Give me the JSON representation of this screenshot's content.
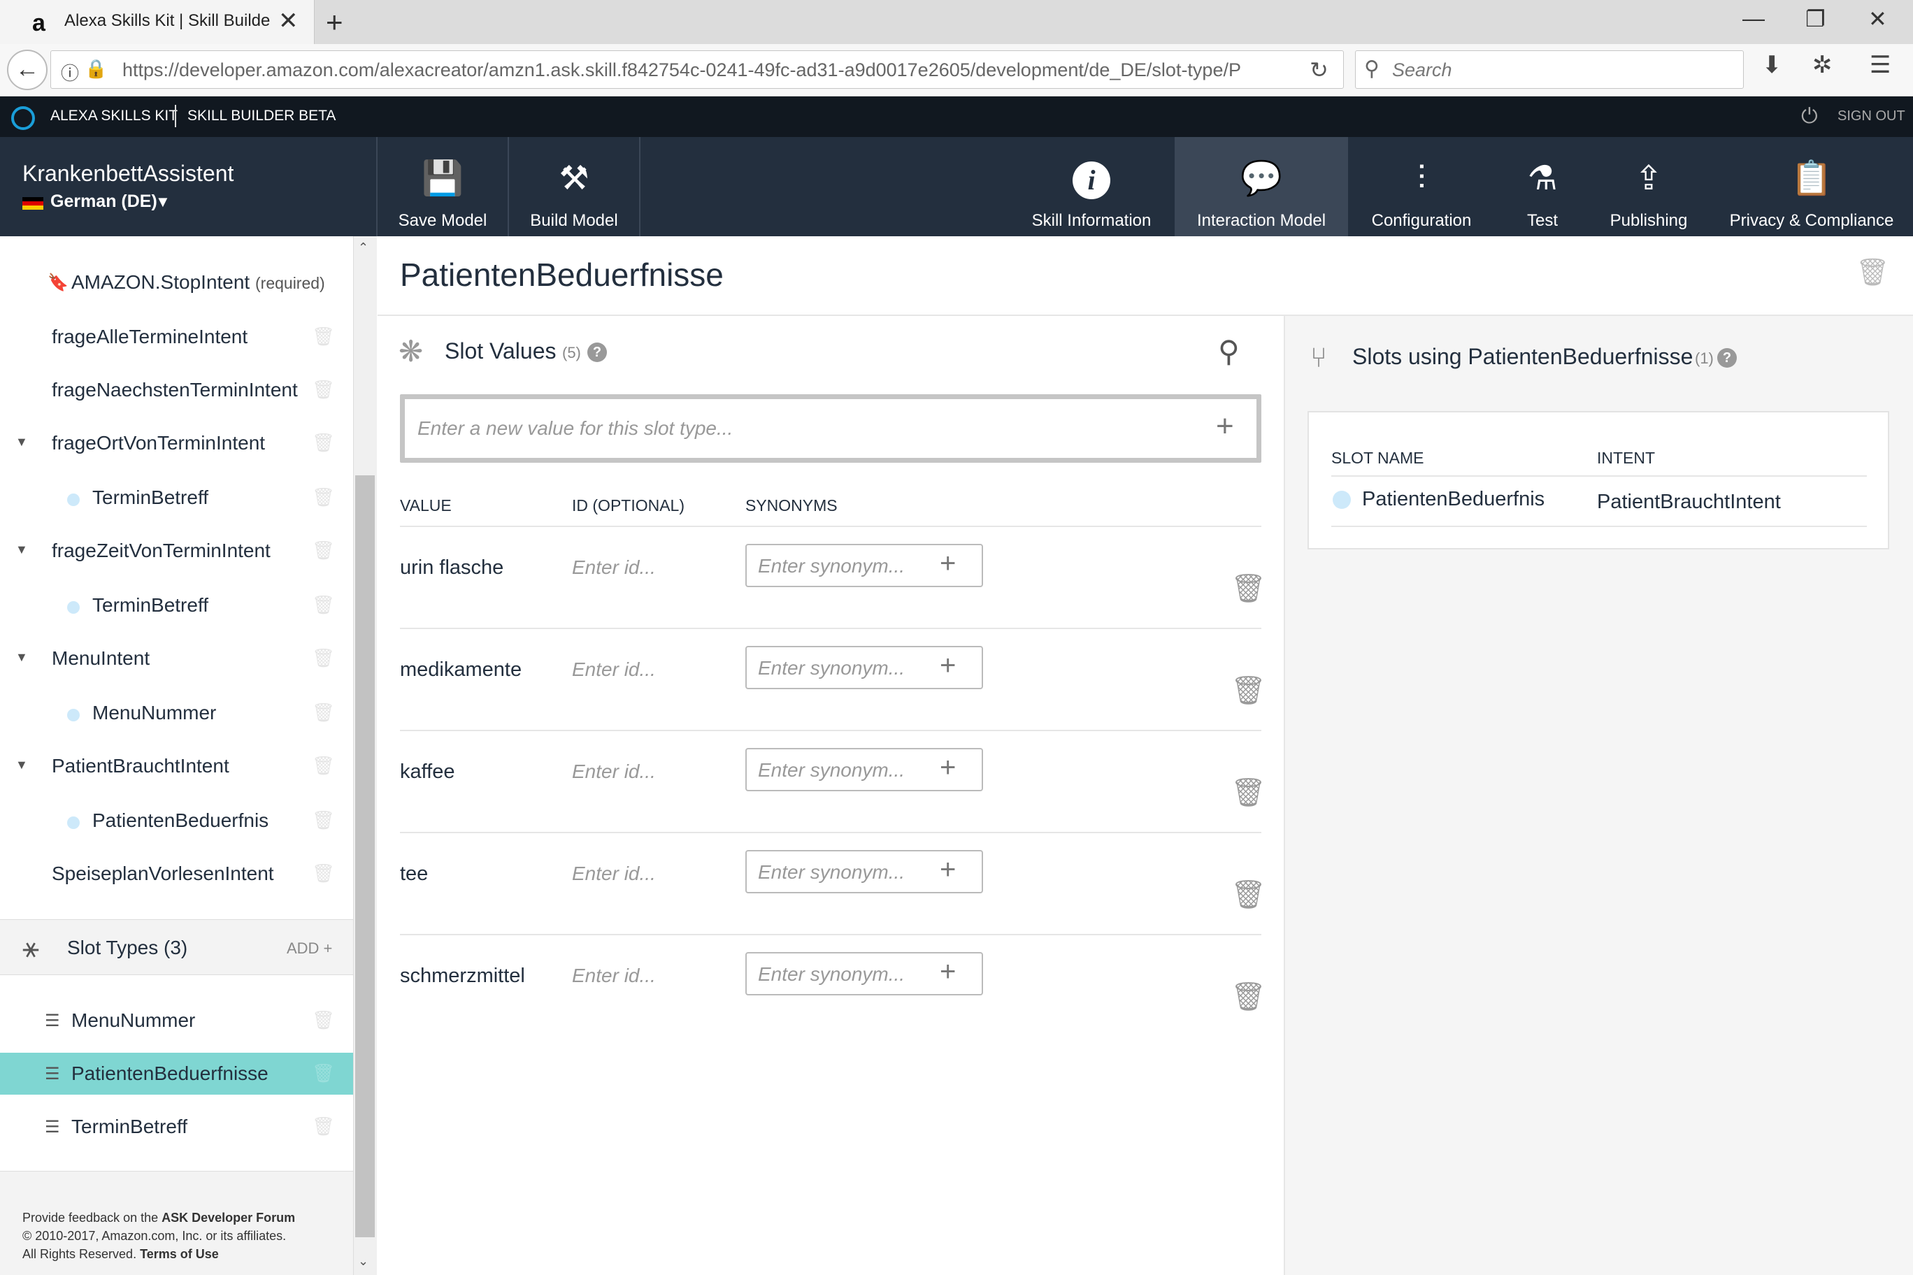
{
  "browser": {
    "tab_title": "Alexa Skills Kit | Skill Builder",
    "favicon": "a",
    "url": "https://developer.amazon.com/alexacreator/amzn1.ask.skill.f842754c-0241-49fc-ad31-a9d0017e2605/development/de_DE/slot-type/P",
    "search_placeholder": "Search"
  },
  "ask_bar": {
    "title": "ALEXA SKILLS KIT",
    "subtitle": "SKILL BUILDER BETA",
    "sign_out": "SIGN OUT"
  },
  "skill": {
    "name": "KrankenbettAssistent",
    "locale": "German (DE)"
  },
  "toolbar": {
    "save_model": "Save Model",
    "build_model": "Build Model",
    "skill_information": "Skill Information",
    "interaction_model": "Interaction Model",
    "configuration": "Configuration",
    "test": "Test",
    "publishing": "Publishing",
    "privacy": "Privacy & Compliance",
    "active": "Interaction Model"
  },
  "sidebar": {
    "intents": [
      {
        "label": "AMAZON.StopIntent",
        "suffix": "(required)"
      },
      {
        "label": "frageAlleTermineIntent"
      },
      {
        "label": "frageNaechstenTerminIntent"
      },
      {
        "label": "frageOrtVonTerminIntent"
      },
      {
        "label": "TerminBetreff"
      },
      {
        "label": "frageZeitVonTerminIntent"
      },
      {
        "label": "TerminBetreff"
      },
      {
        "label": "MenuIntent"
      },
      {
        "label": "MenuNummer"
      },
      {
        "label": "PatientBrauchtIntent"
      },
      {
        "label": "PatientenBeduerfnis"
      },
      {
        "label": "SpeiseplanVorlesenIntent"
      }
    ],
    "slot_types_label": "Slot Types (3)",
    "add_label": "ADD +",
    "slot_types": [
      {
        "label": "MenuNummer"
      },
      {
        "label": "PatientenBeduerfnisse"
      },
      {
        "label": "TerminBetreff"
      }
    ],
    "footer": {
      "line1_prefix": "Provide feedback on the ",
      "line1_link": "ASK Developer Forum",
      "line2": "© 2010-2017, Amazon.com, Inc. or its affiliates.",
      "line3_prefix": "All Rights Reserved. ",
      "line3_link": "Terms of Use"
    }
  },
  "main": {
    "title": "PatientenBeduerfnisse",
    "slot_values": {
      "title": "Slot Values",
      "count": "(5)",
      "new_value_placeholder": "Enter a new value for this slot type...",
      "columns": [
        "VALUE",
        "ID (OPTIONAL)",
        "SYNONYMS"
      ],
      "id_placeholder": "Enter id...",
      "synonym_placeholder": "Enter synonym...",
      "rows": [
        {
          "value": "urin flasche"
        },
        {
          "value": "medikamente"
        },
        {
          "value": "kaffee"
        },
        {
          "value": "tee"
        },
        {
          "value": "schmerzmittel"
        }
      ]
    },
    "slots_using": {
      "title": "Slots using PatientenBeduerfnisse",
      "count": "(1)",
      "columns": [
        "SLOT NAME",
        "INTENT"
      ],
      "rows": [
        {
          "slot_name": "PatientenBeduerfnis",
          "intent": "PatientBrauchtIntent"
        }
      ]
    }
  },
  "colors": {
    "header_bg": "#232f3e",
    "top_bar_bg": "#111820",
    "active_tool_bg": "#3b4757",
    "active_slot_type_bg": "#7fd6d2",
    "slot_dot": "#cde9fa"
  }
}
